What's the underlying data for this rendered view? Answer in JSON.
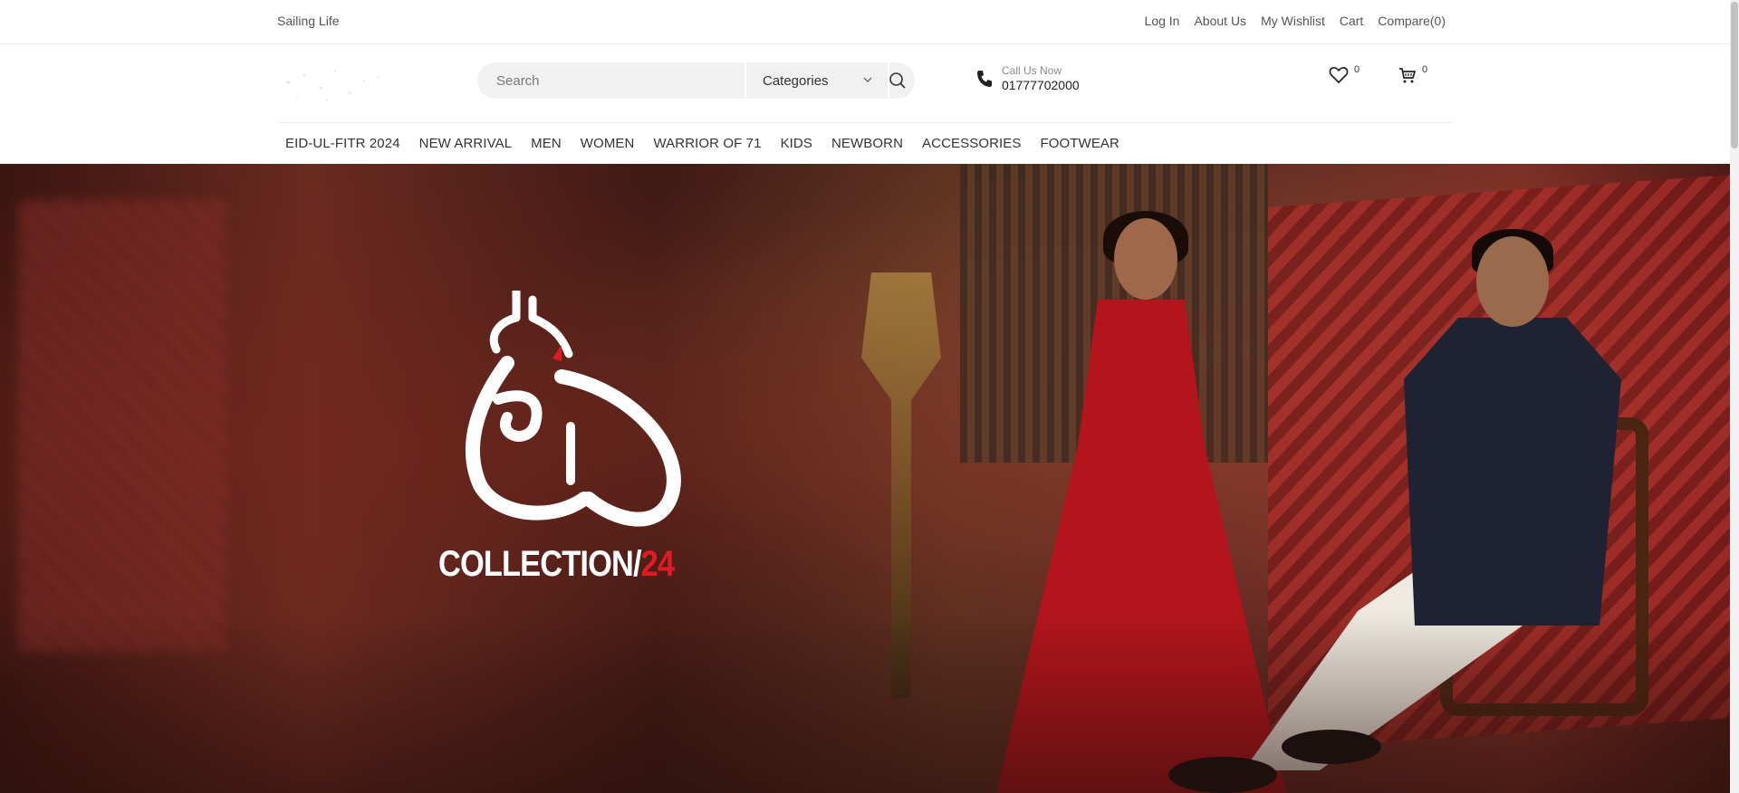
{
  "topbar": {
    "brand": "Sailing Life",
    "links": [
      "Log In",
      "About Us",
      "My Wishlist",
      "Cart",
      "Compare(0)"
    ]
  },
  "header": {
    "search": {
      "placeholder": "Search"
    },
    "categories_label": "Categories",
    "call": {
      "label": "Call Us Now",
      "number": "01777702000"
    },
    "wishlist_count": "0",
    "cart_count": "0"
  },
  "nav": [
    "EID-UL-FITR 2024",
    "NEW ARRIVAL",
    "MEN",
    "WOMEN",
    "WARRIOR OF 71",
    "KIDS",
    "NEWBORN",
    "ACCESSORIES",
    "FOOTWEAR"
  ],
  "hero": {
    "collection": "COLLECTION/",
    "year": "24"
  },
  "colors": {
    "accent_red": "#e01b24",
    "search_bg": "#f1f1f1"
  }
}
